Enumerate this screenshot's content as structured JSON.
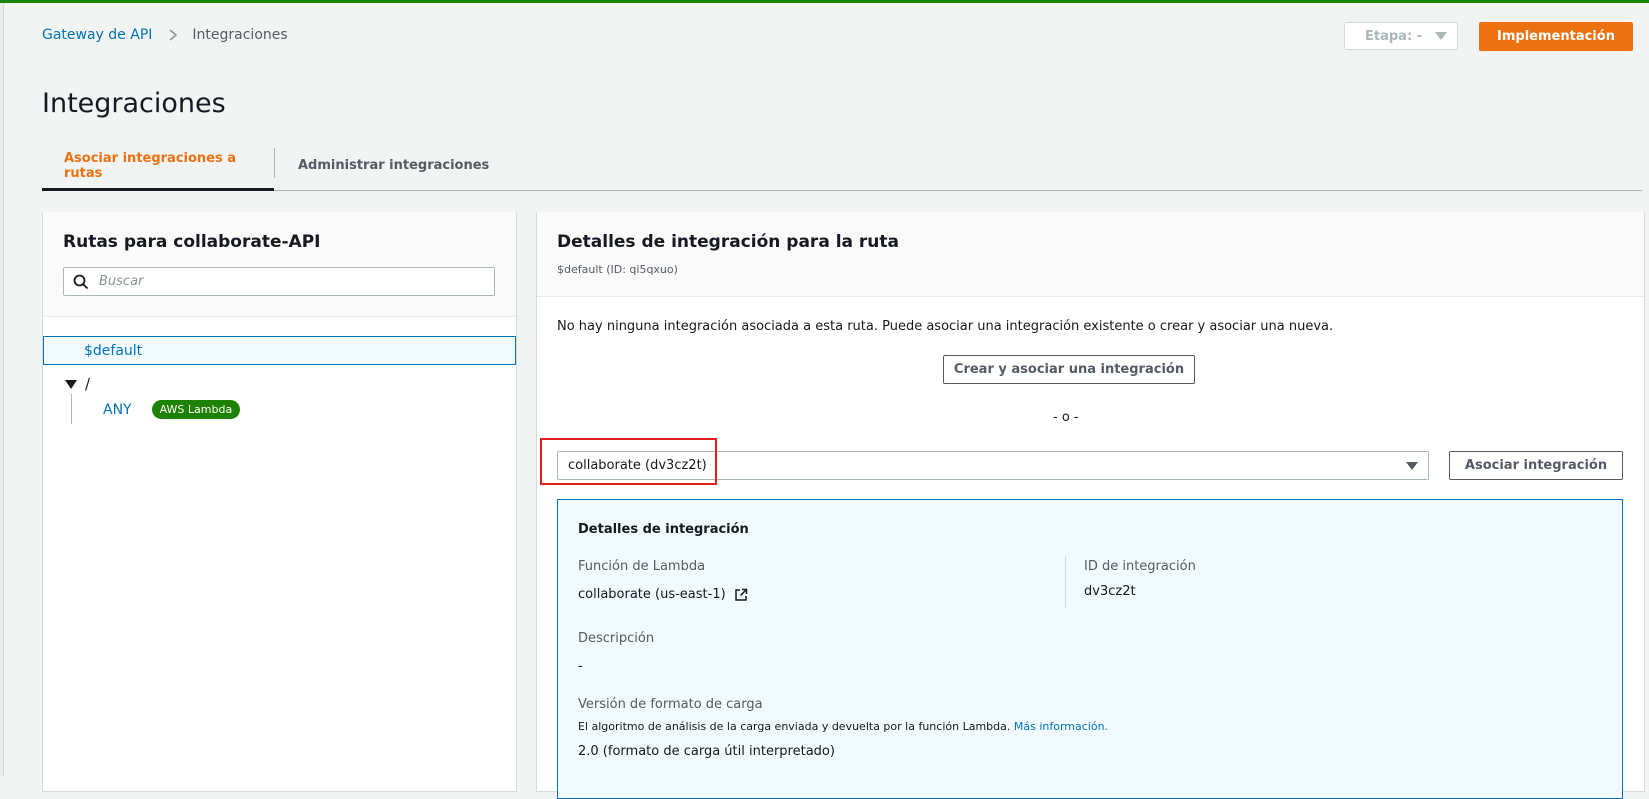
{
  "breadcrumb": {
    "root": "Gateway de API",
    "current": "Integraciones"
  },
  "header": {
    "stage_label": "Etapa: -",
    "deploy_label": "Implementación"
  },
  "page": {
    "title": "Integraciones"
  },
  "tabs": [
    {
      "label": "Asociar integraciones a rutas",
      "active": true
    },
    {
      "label": "Administrar integraciones",
      "active": false
    }
  ],
  "routes_panel": {
    "title": "Rutas para collaborate-API",
    "search_placeholder": "Buscar",
    "routes": {
      "default": "$default",
      "root": "/",
      "method": "ANY",
      "method_badge": "AWS Lambda"
    }
  },
  "details_panel": {
    "title": "Detalles de integración para la ruta",
    "subtitle": "$default (ID: qi5qxuo)",
    "message": "No hay ninguna integración asociada a esta ruta. Puede asociar una integración existente o crear y asociar una nueva.",
    "create_button": "Crear y asociar una integración",
    "or_text": "- o -",
    "selected_integration": "collaborate (dv3cz2t)",
    "associate_button": "Asociar integración"
  },
  "integration_details": {
    "title": "Detalles de integración",
    "lambda_label": "Función de Lambda",
    "lambda_value": "collaborate (us-east-1)",
    "id_label": "ID de integración",
    "id_value": "dv3cz2t",
    "description_label": "Descripción",
    "description_value": "-",
    "payload_label": "Versión de formato de carga",
    "payload_help": "El algoritmo de análisis de la carga enviada y devuelta por la función Lambda.",
    "payload_help_link": "Más información.",
    "payload_value_partial": "2.0 (formato de carga útil interpretado)"
  },
  "colors": {
    "accent_orange": "#ec7211",
    "link_blue": "#0073bb",
    "badge_green": "#1d8102",
    "highlight_red": "#e02020"
  }
}
